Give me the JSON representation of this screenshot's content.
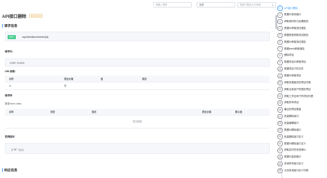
{
  "search": {
    "keyword_placeholder": "请输入搜索",
    "scope_value": "全部",
    "url_placeholder": "按接口路径从头搜索"
  },
  "page": {
    "title": "API接口删除",
    "tag": "deprecated"
  },
  "sections": {
    "request_info": "请求信息",
    "response_info": "响应信息"
  },
  "request": {
    "method": "GET",
    "url": "/api/definition/delete/{id}",
    "headers_label": "请求头:",
    "header_value": "CSRF-TOKEN",
    "url_params_label": "URL参数:",
    "body_label": "请求体",
    "body_type": "类型:form-data",
    "example_label": "范例展示",
    "example_value": "{\"0\":{}}"
  },
  "url_params_table": {
    "columns": [
      "名称",
      "是否必填",
      "值",
      "描述"
    ],
    "rows": [
      [
        "id",
        "是",
        "",
        ""
      ]
    ]
  },
  "body_table": {
    "columns": [
      "名称",
      "类型",
      "描述",
      "是否必填",
      "默认值"
    ],
    "empty_text": "暂无数据"
  },
  "nav": {
    "items": [
      {
        "num": "1",
        "label": "API接口删除",
        "active": true
      },
      {
        "num": "2",
        "label": "根据ID查询接口"
      },
      {
        "num": "3",
        "label": "获取临时执行结果报告"
      },
      {
        "num": "4",
        "label": "根据ID获取测试报告"
      },
      {
        "num": "5",
        "label": "根据类型获取测试报告"
      },
      {
        "num": "6",
        "label": "根据ID获取测试报告"
      },
      {
        "num": "7",
        "label": "根据testId获取报告"
      },
      {
        "num": "8",
        "label": "删除项目"
      },
      {
        "num": "9",
        "label": "根据项目ID获取项目"
      },
      {
        "num": "10",
        "label": "根据项目下的文件"
      },
      {
        "num": "11",
        "label": "根据ID获取项目"
      },
      {
        "num": "12",
        "label": "获取所属组织的项目列表"
      },
      {
        "num": "13",
        "label": "获取当前用户所属的项目"
      },
      {
        "num": "14",
        "label": "获取工作空间下的项目列表"
      },
      {
        "num": "15",
        "label": "获取所有项目"
      },
      {
        "num": "16",
        "label": "最近的项目数量"
      },
      {
        "num": "17",
        "label": "批量删除接口"
      },
      {
        "num": "18",
        "label": "批量编辑接口"
      },
      {
        "num": "19",
        "label": "根据ID删除接口"
      },
      {
        "num": "20",
        "label": "批量删除接口定义"
      },
      {
        "num": "21",
        "label": "根据ID删除接口定义"
      },
      {
        "num": "22",
        "label": "获取定时任务资源id"
      },
      {
        "num": "23",
        "label": "根据ID复制接口"
      },
      {
        "num": "24",
        "label": "查询所有接口定义"
      },
      {
        "num": "25",
        "label": "分页查询接口定义列表"
      }
    ]
  }
}
